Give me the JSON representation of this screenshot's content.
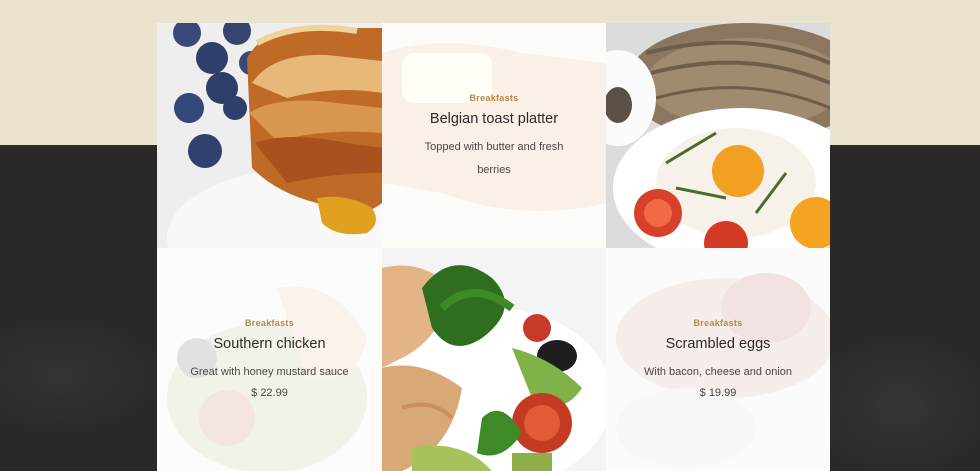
{
  "menu": {
    "items": [
      {
        "category": "Breakfasts",
        "title": "Belgian toast platter",
        "description": "Topped with butter and fresh berries",
        "price": ""
      },
      {
        "category": "Breakfasts",
        "title": "Southern chicken",
        "description": "Great with honey mustard sauce",
        "price": "$ 22.99"
      },
      {
        "category": "Breakfasts",
        "title": "Scrambled eggs",
        "description": "With bacon, cheese and onion",
        "price": "$ 19.99"
      }
    ]
  },
  "images": {
    "toast": "french-toast-with-blueberries-and-syrup",
    "eggs": "fried-eggs-with-tomatoes-and-herbs",
    "salad": "chicken-salad-with-olives-and-parsley"
  }
}
